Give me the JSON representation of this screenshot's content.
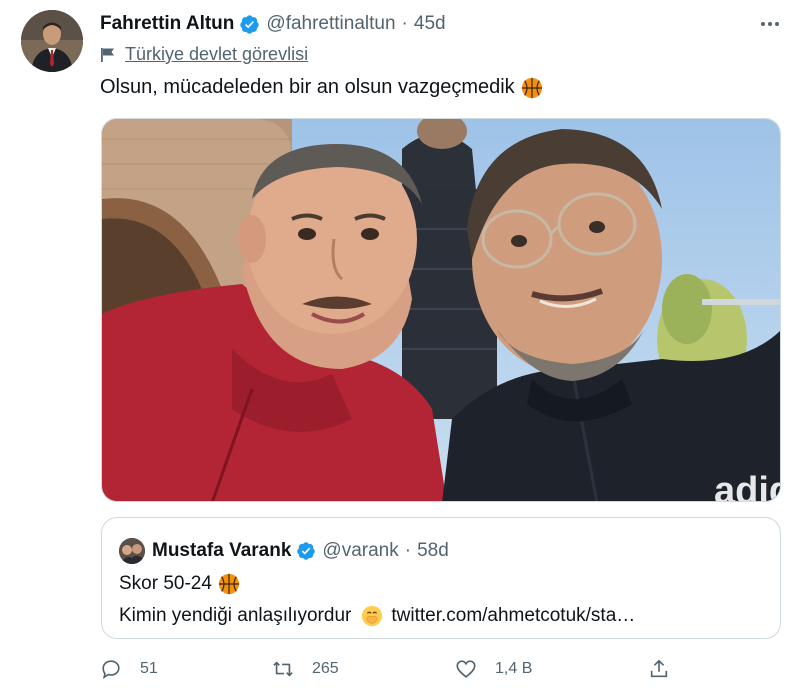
{
  "tweet": {
    "author": {
      "name": "Fahrettin Altun",
      "handle": "@fahrettinaltun",
      "time": "45d",
      "label": "Türkiye devlet görevlisi",
      "verified": true
    },
    "text": "Olsun, mücadeleden bir an olsun vazgeçmedik",
    "text_emoji": "basketball-emoji",
    "media": {
      "alt": ""
    },
    "quoted": {
      "name": "Mustafa Varank",
      "handle": "@varank",
      "time": "58d",
      "line1": "Skor 50-24",
      "line2_text": "Kimin yendiği anlaşılıyordur",
      "line2_link": "twitter.com/ahmetcotuk/sta…"
    },
    "actions": {
      "replies": "51",
      "retweets": "265",
      "likes": "1,4 B"
    },
    "separator": "·"
  },
  "icons": [
    "verified-badge-icon",
    "flag-icon",
    "more-icon",
    "reply-icon",
    "retweet-icon",
    "like-icon",
    "share-icon",
    "basketball-emoji",
    "hand-over-mouth-emoji"
  ],
  "colors": {
    "verified": "#1d9bf0",
    "secondary_text": "#536471",
    "primary_text": "#0f1419",
    "border": "#cfd9de"
  }
}
